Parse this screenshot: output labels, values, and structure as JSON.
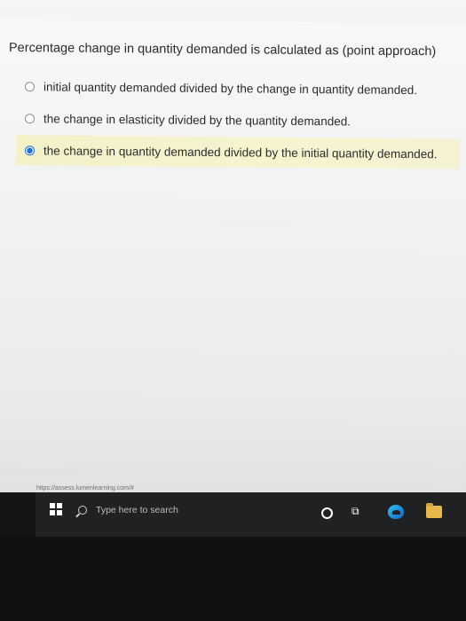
{
  "question": {
    "text": "Percentage change in quantity demanded is calculated as (point approach)"
  },
  "options": [
    {
      "label": "initial quantity demanded divided by the change in quantity demanded.",
      "selected": false
    },
    {
      "label": "the change in elasticity divided by the quantity demanded.",
      "selected": false
    },
    {
      "label": "the change in quantity demanded divided by the initial quantity demanded.",
      "selected": true
    }
  ],
  "status_url": "https://assess.lumenlearning.com/#",
  "taskbar": {
    "search_placeholder": "Type here to search",
    "icons": [
      "windows-start-icon",
      "search-icon",
      "cortana-icon",
      "task-view-icon",
      "edge-browser-icon",
      "file-explorer-icon"
    ]
  },
  "colors": {
    "selected_highlight": "#f5f3cd",
    "radio_selected": "#1e6fd9",
    "taskbar": "#202122"
  }
}
